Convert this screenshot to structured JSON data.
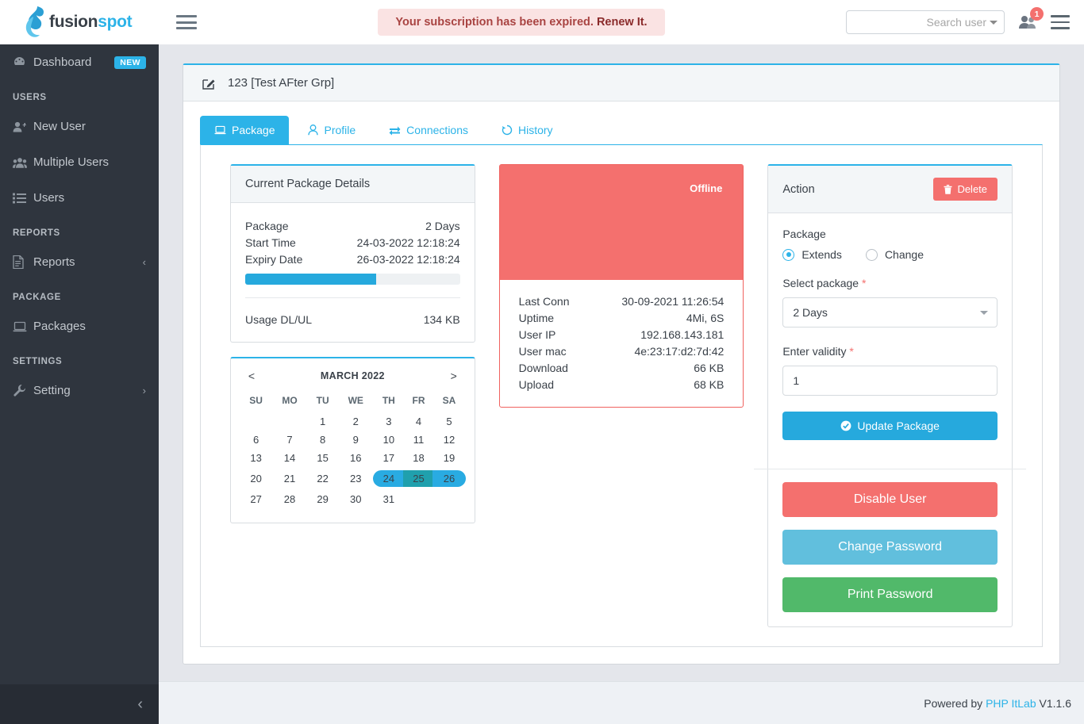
{
  "brand": {
    "name_part1": "fusion",
    "name_part2": "spot"
  },
  "topbar": {
    "alert_text": "Your subscription has been expired.",
    "alert_link": "Renew It.",
    "search_placeholder": "Search user",
    "search_value": "Search user",
    "notification_count": "1"
  },
  "sidebar": {
    "items": [
      {
        "label": "Dashboard",
        "icon": "dashboard-icon",
        "badge": "NEW"
      },
      {
        "label": "New User",
        "icon": "user-plus-icon"
      },
      {
        "label": "Multiple Users",
        "icon": "users-icon"
      },
      {
        "label": "Users",
        "icon": "list-icon"
      },
      {
        "label": "Reports",
        "icon": "file-icon",
        "chevron": "‹"
      },
      {
        "label": "Packages",
        "icon": "laptop-icon"
      },
      {
        "label": "Setting",
        "icon": "wrench-icon",
        "chevron": "›"
      }
    ],
    "sections": {
      "users": "USERS",
      "reports": "REPORTS",
      "package": "PACKAGE",
      "settings": "SETTINGS"
    },
    "collapse_arrow": "‹"
  },
  "page": {
    "title": "123 [Test AFter Grp]",
    "tabs": [
      {
        "label": "Package",
        "icon": "laptop-icon",
        "active": true
      },
      {
        "label": "Profile",
        "icon": "user-icon",
        "active": false
      },
      {
        "label": "Connections",
        "icon": "exchange-icon",
        "active": false
      },
      {
        "label": "History",
        "icon": "history-icon",
        "active": false
      }
    ]
  },
  "current_package": {
    "heading": "Current Package Details",
    "rows": [
      {
        "key": "Package",
        "value": "2 Days"
      },
      {
        "key": "Start Time",
        "value": "24-03-2022 12:18:24"
      },
      {
        "key": "Expiry Date",
        "value": "26-03-2022 12:18:24"
      }
    ],
    "progress_percent": 61,
    "usage_key": "Usage DL/UL",
    "usage_value": "134 KB"
  },
  "calendar": {
    "prev": "<",
    "next": ">",
    "title": "MARCH 2022",
    "weekdays": [
      "SU",
      "MO",
      "TU",
      "WE",
      "TH",
      "FR",
      "SA"
    ],
    "weeks": [
      [
        "",
        "",
        "1",
        "2",
        "3",
        "4",
        "5"
      ],
      [
        "6",
        "7",
        "8",
        "9",
        "10",
        "11",
        "12"
      ],
      [
        "13",
        "14",
        "15",
        "16",
        "17",
        "18",
        "19"
      ],
      [
        "20",
        "21",
        "22",
        "23",
        "24",
        "25",
        "26"
      ],
      [
        "27",
        "28",
        "29",
        "30",
        "31",
        "",
        ""
      ]
    ],
    "highlight_start": "24",
    "highlight_mid": "25",
    "highlight_end": "26"
  },
  "status": {
    "label": "Offline",
    "rows": [
      {
        "key": "Last Conn",
        "value": "30-09-2021 11:26:54"
      },
      {
        "key": "Uptime",
        "value": "4Mi, 6S"
      },
      {
        "key": "User IP",
        "value": "192.168.143.181"
      },
      {
        "key": "User mac",
        "value": "4e:23:17:d2:7d:42"
      },
      {
        "key": "Download",
        "value": "66 KB"
      },
      {
        "key": "Upload",
        "value": "68 KB"
      }
    ]
  },
  "action": {
    "heading": "Action",
    "delete_label": "Delete",
    "package_label": "Package",
    "radio_extends": "Extends",
    "radio_change": "Change",
    "select_package_label": "Select package",
    "select_package_value": "2 Days",
    "validity_label": "Enter validity",
    "validity_value": "1",
    "update_label": "Update Package",
    "disable_user_label": "Disable User",
    "change_password_label": "Change Password",
    "print_password_label": "Print Password",
    "required_mark": "*"
  },
  "footer": {
    "powered_by": "Powered by",
    "company": "PHP ItLab",
    "version": "V1.1.6"
  },
  "colors": {
    "accent": "#2cb3e8",
    "danger": "#f4706e",
    "success": "#51b96a",
    "sidebar": "#2f353e",
    "calendar_mid": "#20a0ad"
  }
}
